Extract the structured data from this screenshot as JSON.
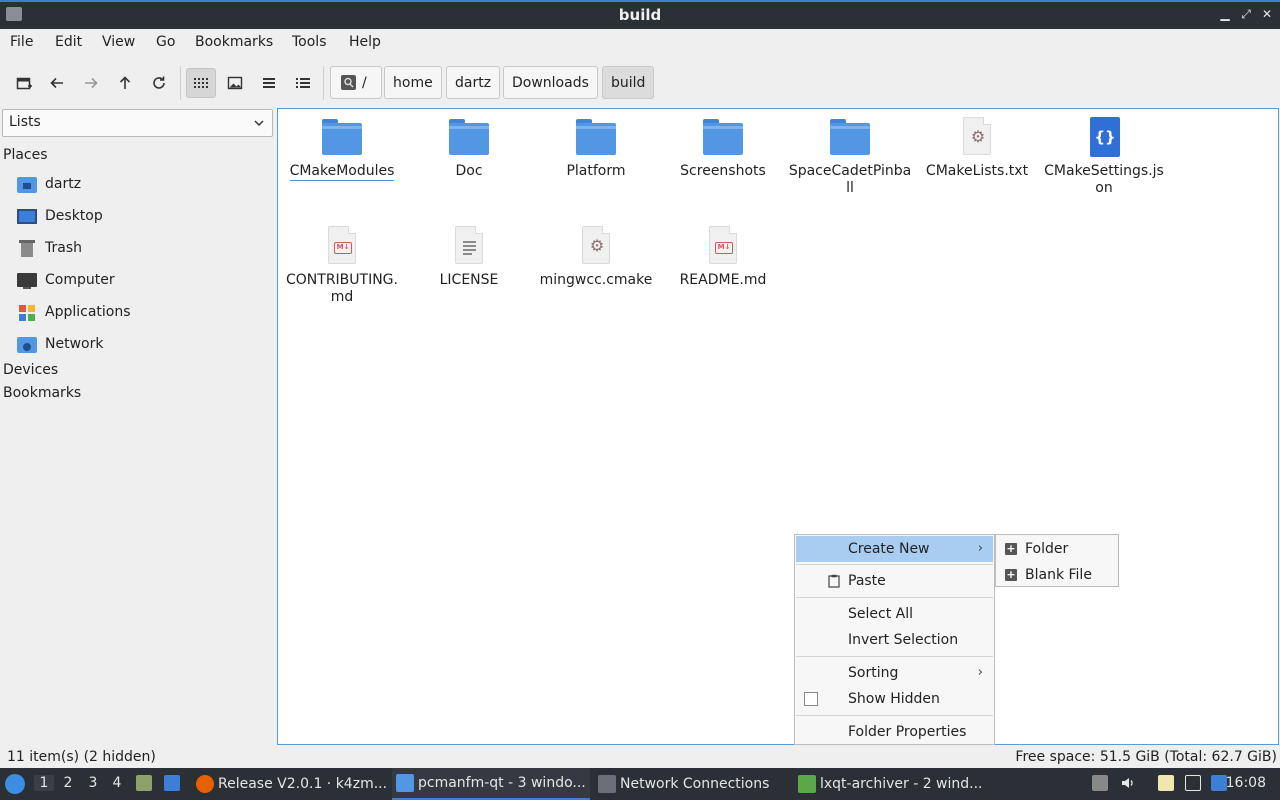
{
  "window": {
    "title": "build"
  },
  "menubar": {
    "items": [
      "File",
      "Edit",
      "View",
      "Go",
      "Bookmarks",
      "Tools",
      "Help"
    ]
  },
  "toolbar": {
    "icons": [
      "new-tab-icon",
      "back-icon",
      "forward-icon",
      "up-icon",
      "reload-icon",
      "icon-view-icon",
      "thumbnail-view-icon",
      "compact-view-icon",
      "detailed-view-icon"
    ],
    "breadcrumbs": [
      "/",
      "home",
      "dartz",
      "Downloads",
      "build"
    ]
  },
  "sidebar": {
    "selector": "Lists",
    "places_header": "Places",
    "places": [
      "dartz",
      "Desktop",
      "Trash",
      "Computer",
      "Applications",
      "Network"
    ],
    "devices_header": "Devices",
    "bookmarks_header": "Bookmarks"
  },
  "files": [
    {
      "name": "CMakeModules",
      "type": "folder"
    },
    {
      "name": "Doc",
      "type": "folder"
    },
    {
      "name": "Platform",
      "type": "folder"
    },
    {
      "name": "Screenshots",
      "type": "folder"
    },
    {
      "name": "SpaceCadetPinball",
      "type": "folder"
    },
    {
      "name": "CMakeLists.txt",
      "type": "cmake"
    },
    {
      "name": "CMakeSettings.json",
      "type": "json"
    },
    {
      "name": "CONTRIBUTING.md",
      "type": "markdown"
    },
    {
      "name": "LICENSE",
      "type": "text"
    },
    {
      "name": "mingwcc.cmake",
      "type": "cmake"
    },
    {
      "name": "README.md",
      "type": "markdown"
    }
  ],
  "context_menu": {
    "create_new": "Create New",
    "paste": "Paste",
    "select_all": "Select All",
    "invert_selection": "Invert Selection",
    "sorting": "Sorting",
    "show_hidden": "Show Hidden",
    "show_hidden_checked": false,
    "folder_properties": "Folder Properties"
  },
  "submenu": {
    "folder": "Folder",
    "blank_file": "Blank File"
  },
  "status": {
    "items": "11 item(s) (2 hidden)",
    "free_space": "Free space: 51.5 GiB (Total: 62.7 GiB)"
  },
  "taskbar": {
    "workspaces": [
      "1",
      "2",
      "3",
      "4"
    ],
    "tasks": [
      "Release V2.0.1 · k4zm...",
      "pcmanfm-qt - 3 windo...",
      "Network Connections",
      "lxqt-archiver - 2 wind..."
    ],
    "clock": "16:08"
  },
  "colors": {
    "accent": "#3d7fd6",
    "folder": "#5197e4",
    "menu_highlight": "#a9cdf0"
  }
}
